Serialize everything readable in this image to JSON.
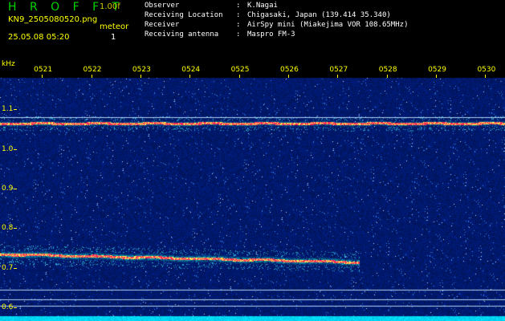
{
  "header": {
    "app_title": "H R O F F T",
    "version": "1.00f",
    "file_name": "KN9_2505080520.png",
    "meteor_label": "meteor",
    "timestamp": "25.05.08 05:20",
    "meteor_count": "1",
    "info": [
      {
        "label": "Observer",
        "sep": ":",
        "value": "K.Nagai"
      },
      {
        "label": "Receiving Location",
        "sep": ":",
        "value": "Chigasaki, Japan (139.414 35.340)"
      },
      {
        "label": "Receiver",
        "sep": ":",
        "value": "AirSpy mini (Miakejima VOR 108.65MHz)"
      },
      {
        "label": "Receiving antenna",
        "sep": ":",
        "value": "Maspro FM-3"
      }
    ]
  },
  "colors": {
    "background": "#000000",
    "noise": "#00208c",
    "signal_core": "#ff2a5a",
    "signal_halo": "#00dcc8",
    "label_yellow": "#ffff00",
    "title_green": "#00d200"
  },
  "chart_data": {
    "type": "heatmap",
    "ylabel": "kHz",
    "yticks": [
      {
        "value": 1.1,
        "label": "1.1"
      },
      {
        "value": 1.0,
        "label": "1.0"
      },
      {
        "value": 0.9,
        "label": "0.9"
      },
      {
        "value": 0.8,
        "label": "0.8"
      },
      {
        "value": 0.7,
        "label": "0.7"
      },
      {
        "value": 0.6,
        "label": "0.6"
      }
    ],
    "ylim": [
      0.58,
      1.18
    ],
    "xticks": [
      {
        "value": 21,
        "label": "0521"
      },
      {
        "value": 22,
        "label": "0522"
      },
      {
        "value": 23,
        "label": "0523"
      },
      {
        "value": 24,
        "label": "0524"
      },
      {
        "value": 25,
        "label": "0525"
      },
      {
        "value": 26,
        "label": "0526"
      },
      {
        "value": 27,
        "label": "0527"
      },
      {
        "value": 28,
        "label": "0528"
      },
      {
        "value": 29,
        "label": "0529"
      },
      {
        "value": 30,
        "label": "0530"
      }
    ],
    "xlim": [
      20.15,
      30.4
    ],
    "series": [
      {
        "x_start": 20.15,
        "x_end": 30.4,
        "freq_start": 1.065,
        "freq_end": 1.065,
        "strength": 0.75
      },
      {
        "x_start": 20.15,
        "x_end": 27.45,
        "freq_start": 0.735,
        "freq_end": 0.715,
        "strength": 1.0
      }
    ],
    "steady_lines": [
      1.08,
      0.645,
      0.62,
      0.605
    ]
  }
}
